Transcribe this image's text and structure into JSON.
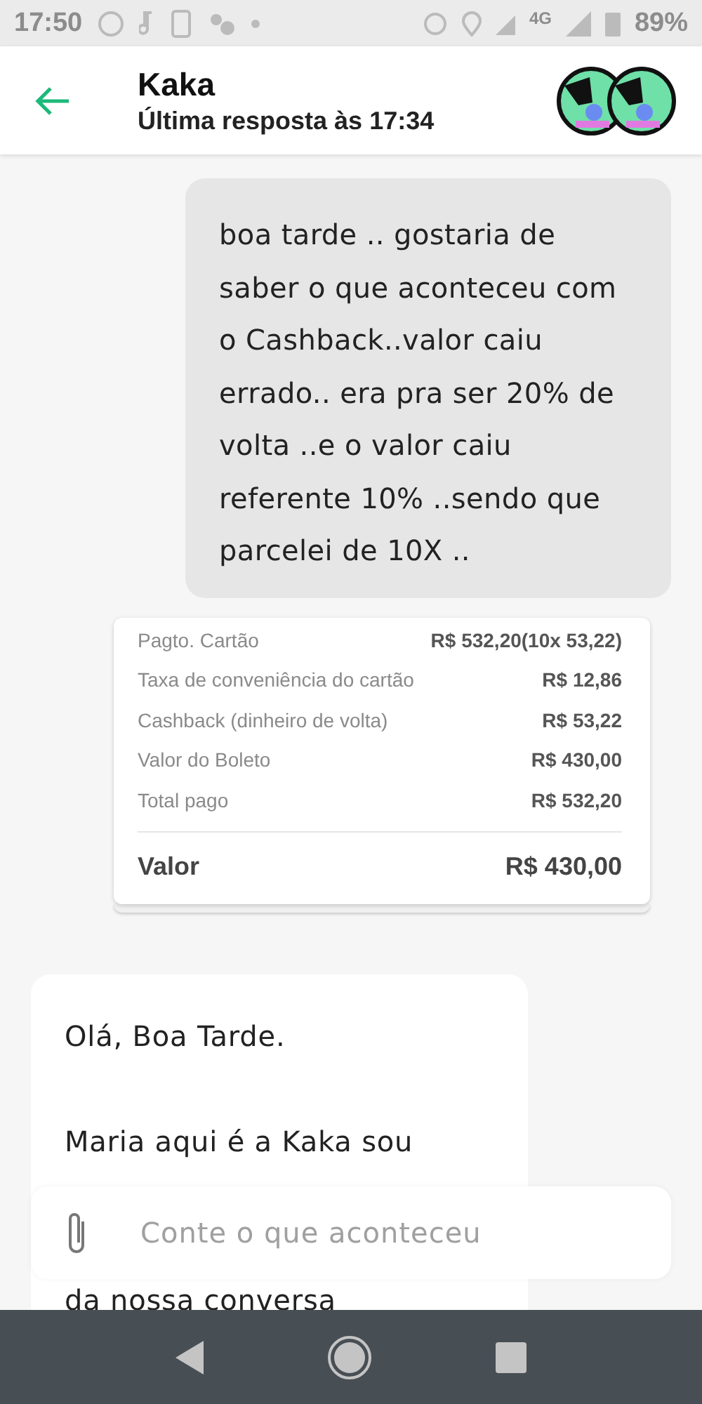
{
  "status_bar": {
    "time": "17:50",
    "network": "4G",
    "battery": "89%"
  },
  "header": {
    "title": "Kaka",
    "subtitle": "Última resposta às 17:34"
  },
  "messages": [
    {
      "kind": "sent",
      "paragraphs": [
        "boa tarde .. gostaria de saber o que aconteceu com o Cashback..valor caiu errado.. era pra ser 20% de volta ..e o valor caiu referente 10% ..sendo que parcelei de 10X .."
      ]
    },
    {
      "kind": "receipt",
      "rows": [
        {
          "label": "Pagto. Cartão",
          "value": "R$ 532,20(10x 53,22)"
        },
        {
          "label": "Taxa de conveniência do cartão",
          "value": "R$ 12,86"
        },
        {
          "label": "Cashback (dinheiro de volta)",
          "value": "R$ 53,22"
        },
        {
          "label": "Valor do Boleto",
          "value": "R$ 430,00"
        },
        {
          "label": "Total pago",
          "value": "R$ 532,20"
        }
      ],
      "total": {
        "label": "Valor",
        "value": "R$ 430,00"
      }
    },
    {
      "kind": "received",
      "paragraphs": [
        "Olá, Boa Tarde.",
        "Maria aqui é a Kaka sou",
        "da nossa conversa"
      ]
    }
  ],
  "composer": {
    "placeholder": "Conte o que aconteceu"
  }
}
